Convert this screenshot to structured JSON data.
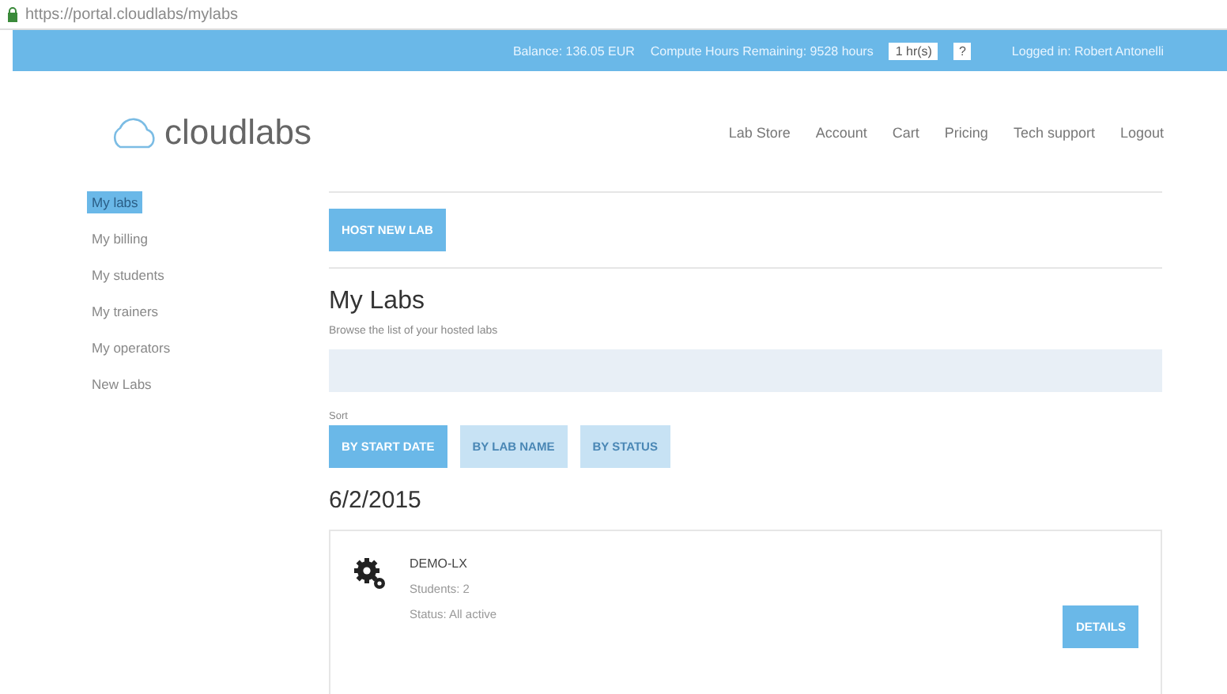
{
  "address_bar": {
    "url": "https://portal.cloudlabs/mylabs"
  },
  "top_bar": {
    "balance": "Balance: 136.05 EUR",
    "hours": "Compute Hours Remaining: 9528 hours",
    "hours_input": "1 hr(s)",
    "help": "?",
    "user": "Logged in: Robert Antonelli"
  },
  "logo": {
    "text": "cloudlabs"
  },
  "nav": [
    "Lab Store",
    "Account",
    "Cart",
    "Pricing",
    "Tech support",
    "Logout"
  ],
  "sidebar": {
    "items": [
      {
        "label": "My labs",
        "selected": true
      },
      {
        "label": "My billing",
        "selected": false
      },
      {
        "label": "My students",
        "selected": false
      },
      {
        "label": "My trainers",
        "selected": false
      },
      {
        "label": "My operators",
        "selected": false
      },
      {
        "label": "New Labs",
        "selected": false
      }
    ]
  },
  "host_button": "HOST NEW LAB",
  "heading": "My Labs",
  "subtitle": "Browse the list of your hosted labs",
  "sort": {
    "label": "Sort",
    "options": [
      {
        "label": "BY START DATE",
        "selected": true
      },
      {
        "label": "BY LAB NAME",
        "selected": false
      },
      {
        "label": "BY STATUS",
        "selected": false
      }
    ]
  },
  "groups": [
    {
      "date": "6/2/2015",
      "labs": [
        {
          "name": "DEMO-LX",
          "students": "Students: 2",
          "status": "Status: All active",
          "button": "DETAILS"
        }
      ]
    }
  ]
}
